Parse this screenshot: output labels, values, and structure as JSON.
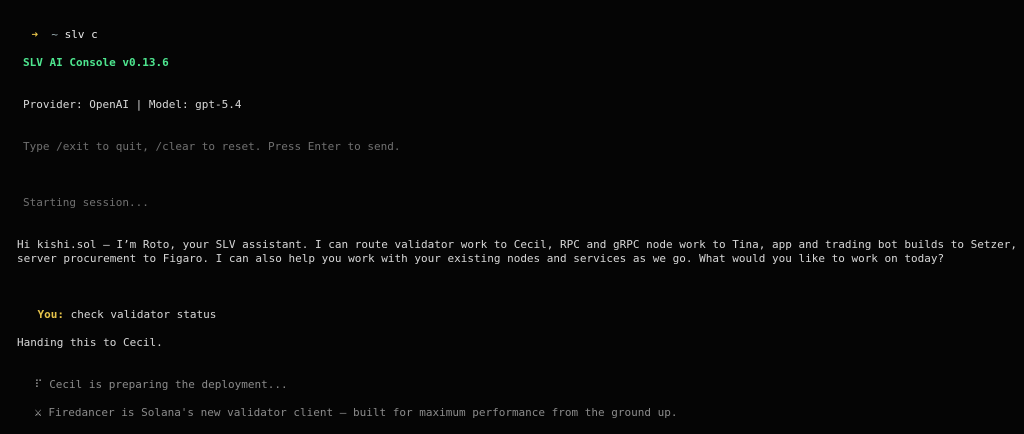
{
  "prompt": {
    "arrow": "➜",
    "cwd": "~",
    "command": "slv c"
  },
  "header": {
    "title": "SLV AI Console v0.13.6",
    "provider_line": "Provider: OpenAI | Model: gpt-5.4",
    "help_line": "Type /exit to quit, /clear to reset. Press Enter to send.",
    "starting": "Starting session..."
  },
  "greeting": {
    "line1": "Hi kishi.sol — I’m Roto, your SLV assistant. I can route validator work to Cecil, RPC and gRPC node work to Tina, app and trading bot builds to Setzer, and",
    "line2": "server procurement to Figaro. I can also help you work with your existing nodes and services as we go. What would you like to work on today?"
  },
  "user": {
    "label": "You:",
    "message": "check validator status"
  },
  "assistant": {
    "handoff": "Handing this to Cecil."
  },
  "status": {
    "spinner": "⠏",
    "preparing": "Cecil is preparing the deployment...",
    "tip_icon": "⚔",
    "tip": "Firedancer is Solana's new validator client — built for maximum performance from the ground up."
  },
  "colors": {
    "background": "#050505",
    "accent_green": "#4ee68f",
    "accent_yellow": "#e6c34a",
    "text": "#d6d6d6",
    "dim": "#8a8a8a"
  }
}
